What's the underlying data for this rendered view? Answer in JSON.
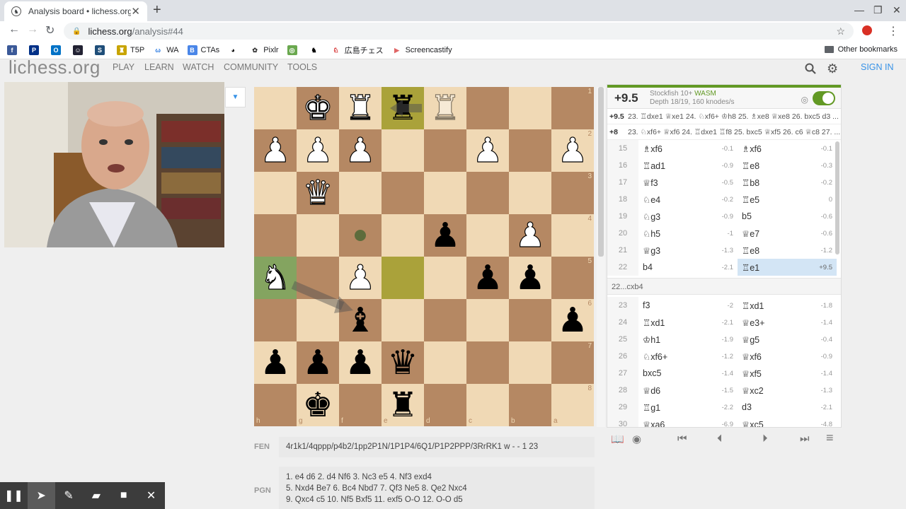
{
  "browser": {
    "tab_title": "Analysis board • lichess.org",
    "url_host": "lichess.org",
    "url_path": "/analysis#44",
    "bookmarks": [
      "",
      "",
      "",
      "",
      "",
      "T5P",
      "WA",
      "CTAs",
      "",
      "Pixlr",
      "",
      "",
      "広島チェス",
      "Screencastify"
    ],
    "other_bookmarks": "Other bookmarks"
  },
  "header": {
    "logo": "lichess.org",
    "nav": [
      "PLAY",
      "LEARN",
      "WATCH",
      "COMMUNITY",
      "TOOLS"
    ],
    "sign_in": "SIGN IN"
  },
  "board": {
    "orientation": "black",
    "ranks": [
      "1",
      "2",
      "3",
      "4",
      "5",
      "6",
      "7",
      "8"
    ],
    "files": [
      "h",
      "g",
      "f",
      "e",
      "d",
      "c",
      "b",
      "a"
    ],
    "rows": [
      [
        "",
        "♚w",
        "♜w",
        "♜b",
        "♜g",
        "",
        "",
        ""
      ],
      [
        "♟w",
        "♟w",
        "♟w",
        "",
        "",
        "♟w",
        "",
        "♟w"
      ],
      [
        "",
        "♛w",
        "",
        "",
        "",
        "",
        "",
        ""
      ],
      [
        "",
        "",
        "dot",
        "",
        "♟b",
        "",
        "♟w",
        ""
      ],
      [
        "♞w",
        "",
        "♟w",
        "",
        "",
        "♟b",
        "♟b",
        ""
      ],
      [
        "",
        "",
        "♝b",
        "",
        "",
        "",
        "",
        "♟b"
      ],
      [
        "♟b",
        "♟b",
        "♟b",
        "♛b",
        "",
        "",
        "",
        ""
      ],
      [
        "",
        "♚b",
        "",
        "♜b",
        "",
        "",
        "",
        ""
      ]
    ],
    "highlights": {
      "0-3": "hl",
      "4-3": "hl",
      "4-0": "green"
    }
  },
  "engine": {
    "score": "+9.5",
    "name": "Stockfish 10+",
    "wasm": "WASM",
    "depth": "Depth 18/19, 160 knodes/s",
    "pv": [
      {
        "eval": "+9.5",
        "line": "23. ♖dxe1 ♕xe1 24. ♘xf6+ ♔h8 25. ♗xe8 ♕xe8 26. bxc5 d3 ..."
      },
      {
        "eval": "+8",
        "line": "23. ♘xf6+ ♕xf6 24. ♖dxe1 ♖f8 25. bxc5 ♕xf5 26. c6 ♕c8 27. ..."
      }
    ]
  },
  "moves_main": [
    {
      "n": "15",
      "w": "♗xf6",
      "we": "-0.1",
      "b": "♗xf6",
      "be": "-0.1"
    },
    {
      "n": "16",
      "w": "♖ad1",
      "we": "-0.9",
      "b": "♖e8",
      "be": "-0.3"
    },
    {
      "n": "17",
      "w": "♕f3",
      "we": "-0.5",
      "b": "♖b8",
      "be": "-0.2"
    },
    {
      "n": "18",
      "w": "♘e4",
      "we": "-0.2",
      "b": "♖e5",
      "be": "0"
    },
    {
      "n": "19",
      "w": "♘g3",
      "we": "-0.9",
      "b": "b5",
      "be": "-0.6"
    },
    {
      "n": "20",
      "w": "♘h5",
      "we": "-1",
      "b": "♕e7",
      "be": "-0.6"
    },
    {
      "n": "21",
      "w": "♕g3",
      "we": "-1.3",
      "b": "♖e8",
      "be": "-1.2"
    },
    {
      "n": "22",
      "w": "b4",
      "we": "-2.1",
      "b": "♖e1",
      "be": "+9.5"
    }
  ],
  "variation": "22...cxb4",
  "moves_after": [
    {
      "n": "23",
      "w": "f3",
      "we": "-2",
      "b": "♖xd1",
      "be": "-1.8"
    },
    {
      "n": "24",
      "w": "♖xd1",
      "we": "-2.1",
      "b": "♕e3+",
      "be": "-1.4"
    },
    {
      "n": "25",
      "w": "♔h1",
      "we": "-1.9",
      "b": "♕g5",
      "be": "-0.4"
    },
    {
      "n": "26",
      "w": "♘xf6+",
      "we": "-1.2",
      "b": "♕xf6",
      "be": "-0.9"
    },
    {
      "n": "27",
      "w": "bxc5",
      "we": "-1.4",
      "b": "♕xf5",
      "be": "-1.4"
    },
    {
      "n": "28",
      "w": "♕d6",
      "we": "-1.5",
      "b": "♕xc2",
      "be": "-1.3"
    },
    {
      "n": "29",
      "w": "♖g1",
      "we": "-2.2",
      "b": "d3",
      "be": "-2.1"
    },
    {
      "n": "30",
      "w": "♕xa6",
      "we": "-6.9",
      "b": "♕xc5",
      "be": "-4.8"
    }
  ],
  "fen_label": "FEN",
  "fen": "4r1k1/4qppp/p4b2/1pp2P1N/1P1P4/6Q1/P1P2PPP/3RrRK1 w - - 1 23",
  "pgn_label": "PGN",
  "pgn_lines": [
    "1. e4 d6 2. d4 Nf6 3. Nc3 e5 4. Nf3 exd4",
    "5. Nxd4 Be7 6. Bc4 Nbd7 7. Qf3 Ne5 8. Qe2 Nxc4",
    "9. Qxc4 c5 10. Nf5 Bxf5 11. exf5 O-O 12. O-O d5"
  ]
}
